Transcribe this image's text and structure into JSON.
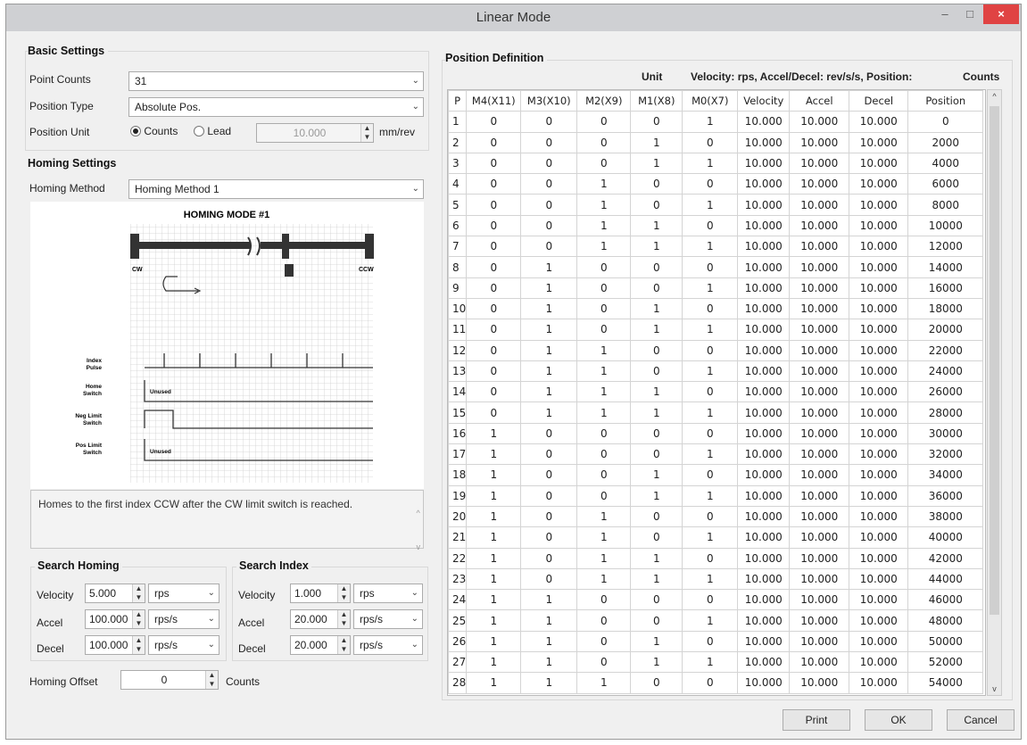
{
  "window": {
    "title": "Linear Mode",
    "minimize": "–",
    "maximize": "□",
    "close": "×"
  },
  "basic": {
    "title": "Basic Settings",
    "point_counts_label": "Point Counts",
    "point_counts": "31",
    "position_type_label": "Position Type",
    "position_type": "Absolute Pos.",
    "position_unit_label": "Position Unit",
    "radio_counts": "Counts",
    "radio_lead": "Lead",
    "lead_value": "10.000",
    "lead_unit": "mm/rev"
  },
  "homing": {
    "title": "Homing Settings",
    "method_label": "Homing Method",
    "method": "Homing Method 1",
    "diagram": {
      "title": "HOMING MODE #1",
      "cw": "CW",
      "ccw": "CCW",
      "index_pulse": "Index\nPulse",
      "home_switch": "Home\nSwitch",
      "neg_limit": "Neg Limit\nSwitch",
      "pos_limit": "Pos Limit\nSwitch",
      "unused": "Unused"
    },
    "description": "Homes to the first index CCW after the CW limit switch is reached."
  },
  "search_homing": {
    "title": "Search Homing",
    "velocity_label": "Velocity",
    "velocity": "5.000",
    "velocity_unit": "rps",
    "accel_label": "Accel",
    "accel": "100.000",
    "accel_unit": "rps/s",
    "decel_label": "Decel",
    "decel": "100.000",
    "decel_unit": "rps/s"
  },
  "search_index": {
    "title": "Search Index",
    "velocity_label": "Velocity",
    "velocity": "1.000",
    "velocity_unit": "rps",
    "accel_label": "Accel",
    "accel": "20.000",
    "accel_unit": "rps/s",
    "decel_label": "Decel",
    "decel": "20.000",
    "decel_unit": "rps/s"
  },
  "offset": {
    "label": "Homing Offset",
    "value": "0",
    "unit": "Counts"
  },
  "position_def": {
    "title": "Position Definition",
    "unit_label": "Unit",
    "unit_text": "Velocity: rps, Accel/Decel: rev/s/s, Position:",
    "unit_counts": "Counts",
    "columns": [
      "P",
      "M4(X11)",
      "M3(X10)",
      "M2(X9)",
      "M1(X8)",
      "M0(X7)",
      "Velocity",
      "Accel",
      "Decel",
      "Position"
    ],
    "rows": [
      [
        "1",
        "0",
        "0",
        "0",
        "0",
        "1",
        "10.000",
        "10.000",
        "10.000",
        "0"
      ],
      [
        "2",
        "0",
        "0",
        "0",
        "1",
        "0",
        "10.000",
        "10.000",
        "10.000",
        "2000"
      ],
      [
        "3",
        "0",
        "0",
        "0",
        "1",
        "1",
        "10.000",
        "10.000",
        "10.000",
        "4000"
      ],
      [
        "4",
        "0",
        "0",
        "1",
        "0",
        "0",
        "10.000",
        "10.000",
        "10.000",
        "6000"
      ],
      [
        "5",
        "0",
        "0",
        "1",
        "0",
        "1",
        "10.000",
        "10.000",
        "10.000",
        "8000"
      ],
      [
        "6",
        "0",
        "0",
        "1",
        "1",
        "0",
        "10.000",
        "10.000",
        "10.000",
        "10000"
      ],
      [
        "7",
        "0",
        "0",
        "1",
        "1",
        "1",
        "10.000",
        "10.000",
        "10.000",
        "12000"
      ],
      [
        "8",
        "0",
        "1",
        "0",
        "0",
        "0",
        "10.000",
        "10.000",
        "10.000",
        "14000"
      ],
      [
        "9",
        "0",
        "1",
        "0",
        "0",
        "1",
        "10.000",
        "10.000",
        "10.000",
        "16000"
      ],
      [
        "10",
        "0",
        "1",
        "0",
        "1",
        "0",
        "10.000",
        "10.000",
        "10.000",
        "18000"
      ],
      [
        "11",
        "0",
        "1",
        "0",
        "1",
        "1",
        "10.000",
        "10.000",
        "10.000",
        "20000"
      ],
      [
        "12",
        "0",
        "1",
        "1",
        "0",
        "0",
        "10.000",
        "10.000",
        "10.000",
        "22000"
      ],
      [
        "13",
        "0",
        "1",
        "1",
        "0",
        "1",
        "10.000",
        "10.000",
        "10.000",
        "24000"
      ],
      [
        "14",
        "0",
        "1",
        "1",
        "1",
        "0",
        "10.000",
        "10.000",
        "10.000",
        "26000"
      ],
      [
        "15",
        "0",
        "1",
        "1",
        "1",
        "1",
        "10.000",
        "10.000",
        "10.000",
        "28000"
      ],
      [
        "16",
        "1",
        "0",
        "0",
        "0",
        "0",
        "10.000",
        "10.000",
        "10.000",
        "30000"
      ],
      [
        "17",
        "1",
        "0",
        "0",
        "0",
        "1",
        "10.000",
        "10.000",
        "10.000",
        "32000"
      ],
      [
        "18",
        "1",
        "0",
        "0",
        "1",
        "0",
        "10.000",
        "10.000",
        "10.000",
        "34000"
      ],
      [
        "19",
        "1",
        "0",
        "0",
        "1",
        "1",
        "10.000",
        "10.000",
        "10.000",
        "36000"
      ],
      [
        "20",
        "1",
        "0",
        "1",
        "0",
        "0",
        "10.000",
        "10.000",
        "10.000",
        "38000"
      ],
      [
        "21",
        "1",
        "0",
        "1",
        "0",
        "1",
        "10.000",
        "10.000",
        "10.000",
        "40000"
      ],
      [
        "22",
        "1",
        "0",
        "1",
        "1",
        "0",
        "10.000",
        "10.000",
        "10.000",
        "42000"
      ],
      [
        "23",
        "1",
        "0",
        "1",
        "1",
        "1",
        "10.000",
        "10.000",
        "10.000",
        "44000"
      ],
      [
        "24",
        "1",
        "1",
        "0",
        "0",
        "0",
        "10.000",
        "10.000",
        "10.000",
        "46000"
      ],
      [
        "25",
        "1",
        "1",
        "0",
        "0",
        "1",
        "10.000",
        "10.000",
        "10.000",
        "48000"
      ],
      [
        "26",
        "1",
        "1",
        "0",
        "1",
        "0",
        "10.000",
        "10.000",
        "10.000",
        "50000"
      ],
      [
        "27",
        "1",
        "1",
        "0",
        "1",
        "1",
        "10.000",
        "10.000",
        "10.000",
        "52000"
      ],
      [
        "28",
        "1",
        "1",
        "1",
        "0",
        "0",
        "10.000",
        "10.000",
        "10.000",
        "54000"
      ]
    ]
  },
  "buttons": {
    "print": "Print",
    "ok": "OK",
    "cancel": "Cancel"
  }
}
